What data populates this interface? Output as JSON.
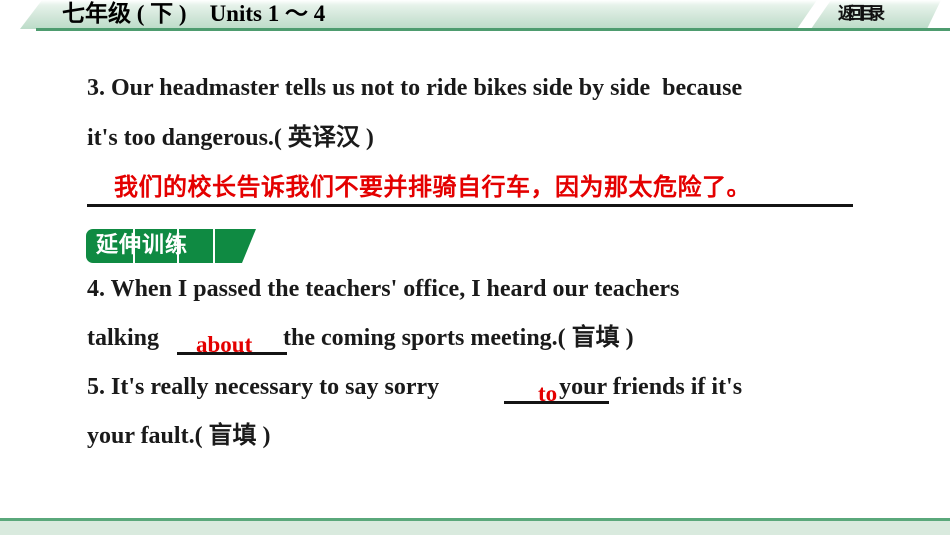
{
  "header": {
    "title": "七年级 ( 下 )    Units 1 ～ 4",
    "return_button_label": "返回目录",
    "accent_color": "#4e9c6f",
    "background_color": "#cfe5d7"
  },
  "badge": {
    "label": "延伸训练",
    "color": "#0f8a42",
    "text_color": "#ffffff"
  },
  "questions": [
    {
      "number": "3.",
      "line1": "3. Our headmaster tells us not to ride bikes side by side  because",
      "line2": "it's too dangerous.( 英译汉 )",
      "type_label": "( 英译汉 )",
      "answer": "我们的校长告诉我们不要并排骑自行车，因为那太危险了。",
      "answer_color": "#e40000"
    },
    {
      "number": "4.",
      "line1": "4. When I passed the teachers' office, I heard our teachers",
      "line2_before": "talking ",
      "line2_after": " the coming sports meeting.( 盲填 )",
      "type_label": "( 盲填 )",
      "answer": "about",
      "answer_color": "#e40000"
    },
    {
      "number": "5.",
      "line1_before": "5. It's really necessary to say sorry ",
      "line1_after": " your friends if it's",
      "line2": "your fault.( 盲填 )",
      "type_label": "( 盲填 )",
      "answer": "to",
      "answer_color": "#e40000"
    }
  ],
  "footer": {
    "rule_color": "#5aa87b",
    "band_color": "#d9eade"
  }
}
